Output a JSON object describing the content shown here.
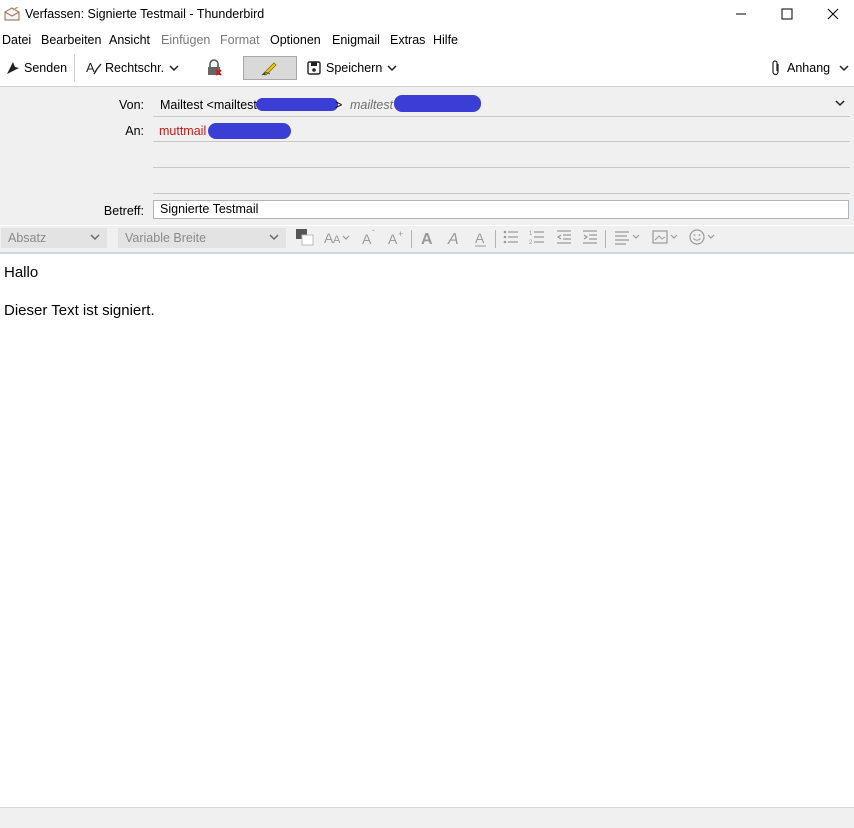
{
  "window": {
    "title": "Verfassen: Signierte Testmail - Thunderbird"
  },
  "menu": {
    "items": [
      {
        "label": "Datei",
        "enabled": true
      },
      {
        "label": "Bearbeiten",
        "enabled": true
      },
      {
        "label": "Ansicht",
        "enabled": true
      },
      {
        "label": "Einfügen",
        "enabled": false
      },
      {
        "label": "Format",
        "enabled": false
      },
      {
        "label": "Optionen",
        "enabled": true
      },
      {
        "label": "Enigmail",
        "enabled": true
      },
      {
        "label": "Extras",
        "enabled": true
      },
      {
        "label": "Hilfe",
        "enabled": true
      }
    ]
  },
  "toolbar": {
    "send_label": "Senden",
    "spelling_label": "Rechtschr.",
    "save_label": "Speichern",
    "attach_label": "Anhang"
  },
  "header": {
    "from_label": "Von:",
    "from_value": "Mailtest <mailtest",
    "from_value_end": ">",
    "from_identity": "mailtest",
    "to_label": "An:",
    "to_value": "muttmail",
    "subject_label": "Betreff:",
    "subject_value": "Signierte Testmail"
  },
  "format": {
    "paragraph_select": "Absatz",
    "font_select": "Variable Breite"
  },
  "body": {
    "lines": [
      "Hallo",
      "Dieser Text ist signiert."
    ]
  },
  "colors": {
    "accent_red": "#c91a1a",
    "redaction": "#3b3ed4"
  }
}
